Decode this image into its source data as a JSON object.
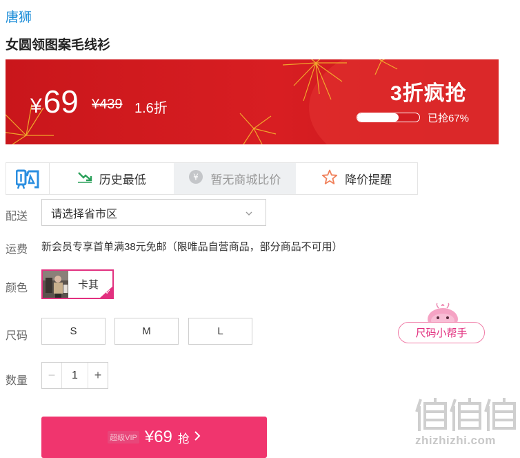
{
  "product": {
    "brand": "唐狮",
    "title": "女圆领图案毛线衫"
  },
  "promo": {
    "currency": "¥",
    "price": "69",
    "original_price": "¥439",
    "discount": "1.6折",
    "flash_title": "3折疯抢",
    "progress_label": "已抢67%",
    "progress_percent": 67,
    "colors": {
      "banner": "#d81e22",
      "accent": "#f0356e"
    }
  },
  "tools": {
    "logo_icon": "gou-logo-icon",
    "history": {
      "icon": "trend-down-icon",
      "label": "历史最低"
    },
    "compare": {
      "icon": "yen-coin-icon",
      "label": "暂无商城比价"
    },
    "alert": {
      "icon": "star-icon",
      "label": "降价提醒"
    }
  },
  "delivery": {
    "label": "配送",
    "placeholder": "请选择省市区"
  },
  "shipping": {
    "label": "运费",
    "text": "新会员专享首单满38元免邮（限唯品自营商品，部分商品不可用）"
  },
  "color": {
    "label": "颜色",
    "selected": "卡其"
  },
  "size": {
    "label": "尺码",
    "options": [
      "S",
      "M",
      "L"
    ],
    "helper": "尺码小帮手"
  },
  "quantity": {
    "label": "数量",
    "minus": "−",
    "value": "1",
    "plus": "+"
  },
  "buy": {
    "badge": "超级VIP",
    "price": "¥69",
    "label": "抢"
  },
  "watermark": {
    "text": "zhizhizhi.com"
  }
}
